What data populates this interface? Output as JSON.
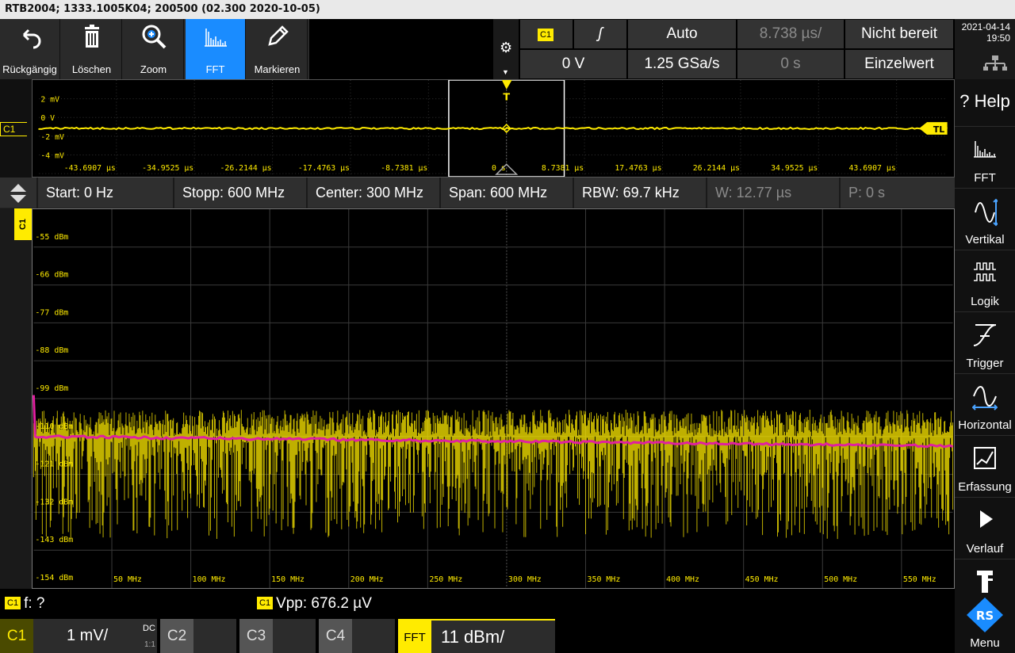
{
  "title_bar": "RTB2004; 1333.1005K04; 200500 (02.300 2020-10-05)",
  "toolbar": [
    {
      "label": "Rückgängig",
      "icon": "undo-icon"
    },
    {
      "label": "Löschen",
      "icon": "trash-icon"
    },
    {
      "label": "Zoom",
      "icon": "zoom-icon"
    },
    {
      "label": "FFT",
      "icon": "fft-icon",
      "active": true
    },
    {
      "label": "Markieren",
      "icon": "pencil-icon"
    }
  ],
  "trigger_panel": {
    "source": "C1",
    "slope_symbol": "ʃ",
    "mode": "Auto",
    "time_scale": "8.738 µs/",
    "status": "Nicht bereit",
    "level": "0 V",
    "sample_rate": "1.25 GSa/s",
    "offset": "0 s",
    "acq_mode": "Einzelwert"
  },
  "datetime": {
    "date": "2021-04-14",
    "time": "19:50"
  },
  "sidebar": [
    {
      "label": "Help",
      "icon": "help-icon"
    },
    {
      "label": "FFT",
      "icon": "fft-icon"
    },
    {
      "label": "Vertikal",
      "icon": "vertical-icon"
    },
    {
      "label": "Logik",
      "icon": "logic-icon"
    },
    {
      "label": "Trigger",
      "icon": "trigger-icon"
    },
    {
      "label": "Horizontal",
      "icon": "horizontal-icon"
    },
    {
      "label": "Erfassung",
      "icon": "acquisition-icon"
    },
    {
      "label": "Verlauf",
      "icon": "play-icon"
    },
    {
      "label": "",
      "icon": "probe-icon"
    },
    {
      "label": "Menu",
      "icon": "rs-logo-icon"
    }
  ],
  "time_plot": {
    "channel": "C1",
    "trigger_label": "TL",
    "trigger_marker": "T",
    "y_labels": [
      "2 mV",
      "0 V",
      "-2 mV",
      "-4 mV"
    ],
    "x_labels": [
      "-43.6907 µs",
      "-34.9525 µs",
      "-26.2144 µs",
      "-17.4763 µs",
      "-8.7381 µs",
      "0 s",
      "8.7381 µs",
      "17.4763 µs",
      "26.2144 µs",
      "34.9525 µs",
      "43.6907 µs"
    ]
  },
  "fft_bar": {
    "start": "Start: 0 Hz",
    "stop": "Stopp: 600 MHz",
    "center": "Center: 300 MHz",
    "span": "Span: 600 MHz",
    "rbw": "RBW: 69.7 kHz",
    "window": "W: 12.77 µs",
    "position": "P: 0 s"
  },
  "fft_plot": {
    "channel": "C1",
    "y_labels": [
      "-55 dBm",
      "-66 dBm",
      "-77 dBm",
      "-88 dBm",
      "-99 dBm",
      "-110 dBm",
      "-121 dBm",
      "-132 dBm",
      "-143 dBm",
      "-154 dBm"
    ],
    "x_labels": [
      "50 MHz",
      "100 MHz",
      "150 MHz",
      "200 MHz",
      "250 MHz",
      "300 MHz",
      "350 MHz",
      "400 MHz",
      "450 MHz",
      "500 MHz",
      "550 MHz"
    ],
    "noise_floor_dbm": -110,
    "trace_color": "#ffeb00",
    "average_color": "#e020a0"
  },
  "measurements": [
    {
      "channel": "C1",
      "text": "f: ?"
    },
    {
      "channel": "C1",
      "text": "Vpp: 676.2 µV"
    }
  ],
  "channels": {
    "c1": {
      "label": "C1",
      "scale": "1 mV/",
      "coupling": "DC",
      "probe": "1:1"
    },
    "c2": {
      "label": "C2"
    },
    "c3": {
      "label": "C3"
    },
    "c4": {
      "label": "C4"
    },
    "fft": {
      "label": "FFT",
      "scale": "11 dBm/"
    }
  }
}
